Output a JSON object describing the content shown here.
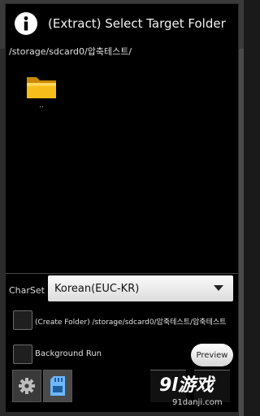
{
  "dialog": {
    "title": "(Extract) Select Target Folder",
    "current_path": "/storage/sdcard0/압축테스트/"
  },
  "folders": [
    {
      "label": ".."
    }
  ],
  "charset": {
    "label": "CharSet",
    "selected": "Korean(EUC-KR)"
  },
  "options": {
    "create_folder_label": "(Create Folder) /storage/sdcard0/압축테스트/압축테스트",
    "background_run_label": "Background Run"
  },
  "buttons": {
    "preview_label": "Preview"
  },
  "watermark": {
    "logo": "9l游戏",
    "url": "91danji.com"
  },
  "colors": {
    "dialog_background": "#000000",
    "folder_yellow": "#f5b800"
  }
}
